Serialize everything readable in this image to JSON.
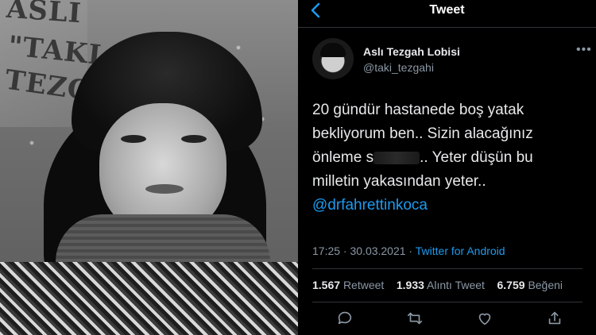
{
  "photo": {
    "sign_lines": [
      "ASLI",
      "\"TAKI",
      "TEZG"
    ]
  },
  "header": {
    "title": "Tweet"
  },
  "tweet": {
    "author_name": "Aslı Tezgah Lobisi",
    "handle": "@taki_tezgahi",
    "text_lines": [
      "20 gündür hastanede boş yatak",
      "bekliyorum ben.. Sizin alacağınız"
    ],
    "line3_prefix": "önleme s",
    "line3_suffix": ".. Yeter düşün bu",
    "line4": "milletin yakasından yeter..",
    "mention": "@drfahrettinkoca",
    "time": "17:25 · 30.03.2021 ·",
    "source": "Twitter for Android",
    "stats": {
      "retweets": "1.567",
      "retweets_label": "Retweet",
      "quotes": "1.933",
      "quotes_label": "Alıntı Tweet",
      "likes": "6.759",
      "likes_label": "Beğeni"
    }
  },
  "icons": {
    "back": "chevron-left-icon",
    "more": "more-horizontal-icon",
    "reply": "comment-icon",
    "retweet": "retweet-icon",
    "like": "heart-icon",
    "share": "share-icon"
  },
  "colors": {
    "accent": "#1d9bf0",
    "muted": "#8b98a5",
    "background": "#000000"
  }
}
